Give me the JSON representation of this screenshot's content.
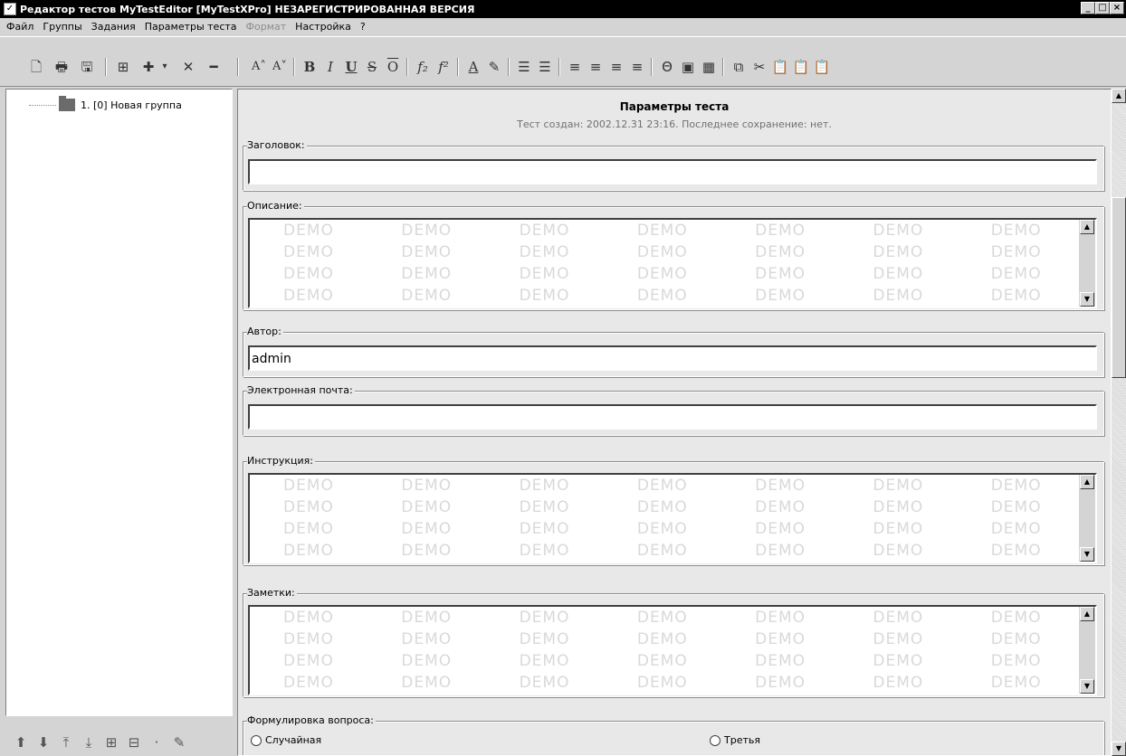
{
  "window": {
    "app_icon": "checkbox-icon",
    "title": "Редактор тестов MyTestEditor [MyTestXPro] НЕЗАРЕГИСТРИРОВАННАЯ ВЕРСИЯ",
    "controls": [
      "minimize-icon",
      "maximize-icon",
      "close-icon"
    ]
  },
  "menu": [
    {
      "label": "Файл"
    },
    {
      "label": "Группы"
    },
    {
      "label": "Задания"
    },
    {
      "label": "Параметры теста"
    },
    {
      "label": "Формат",
      "disabled": true
    },
    {
      "label": "Настройка"
    },
    {
      "label": "?"
    }
  ],
  "toolbar": {
    "file_icons": [
      "new-icon",
      "open-icon",
      "save-icon"
    ],
    "tree_icons": [
      "add-group-icon",
      "add-task-icon",
      "delete-icon",
      "remove-icon"
    ],
    "format_buttons": [
      {
        "icon": "font-increase-icon",
        "glyph": "A˄"
      },
      {
        "icon": "font-decrease-icon",
        "glyph": "A˅"
      },
      {
        "icon": "bold-icon",
        "glyph": "B"
      },
      {
        "icon": "italic-icon",
        "glyph": "I"
      },
      {
        "icon": "underline-icon",
        "glyph": "U"
      },
      {
        "icon": "strikethrough-icon",
        "glyph": "S"
      },
      {
        "icon": "overline-icon",
        "glyph": "O"
      },
      {
        "icon": "subscript-icon",
        "glyph": "f₂"
      },
      {
        "icon": "superscript-icon",
        "glyph": "f²"
      },
      {
        "icon": "font-color-icon",
        "glyph": "A"
      },
      {
        "icon": "highlight-icon",
        "glyph": "✎"
      },
      {
        "icon": "bullet-list-icon",
        "glyph": "☰"
      },
      {
        "icon": "numbered-list-icon",
        "glyph": "☰"
      },
      {
        "icon": "align-left-icon",
        "glyph": "≡"
      },
      {
        "icon": "align-center-icon",
        "glyph": "≡"
      },
      {
        "icon": "align-right-icon",
        "glyph": "≡"
      },
      {
        "icon": "justify-icon",
        "glyph": "≡"
      },
      {
        "icon": "symbol-icon",
        "glyph": "Θ"
      },
      {
        "icon": "image-icon",
        "glyph": "▣"
      },
      {
        "icon": "table-icon",
        "glyph": "▦"
      },
      {
        "icon": "copy-icon",
        "glyph": "⧉"
      },
      {
        "icon": "cut-icon",
        "glyph": "✂"
      },
      {
        "icon": "paste-icon",
        "glyph": "📋"
      },
      {
        "icon": "paste-special-icon",
        "glyph": "📋"
      },
      {
        "icon": "paste-text-icon",
        "glyph": "📋"
      }
    ]
  },
  "tree": {
    "node_label": "1. [0] Новая группа",
    "bottom_icons": [
      "move-up-icon",
      "move-down-icon",
      "move-top-icon",
      "move-bottom-icon",
      "expand-all-icon",
      "collapse-all-icon",
      "dot-icon",
      "edit-icon"
    ]
  },
  "main": {
    "heading": "Параметры теста",
    "created_info": "Тест создан: 2002.12.31 23:16. Последнее сохранение: нет.",
    "title_label": "Заголовок:",
    "title_value": "",
    "description_label": "Описание:",
    "author_label": "Автор:",
    "author_value": "admin",
    "email_label": "Электронная почта:",
    "email_value": "",
    "instruction_label": "Инструкция:",
    "notes_label": "Заметки:",
    "question_label": "Формулировка вопроса:",
    "radio_random": "Случайная",
    "radio_third": "Третья",
    "demo_word": "DEMO"
  }
}
